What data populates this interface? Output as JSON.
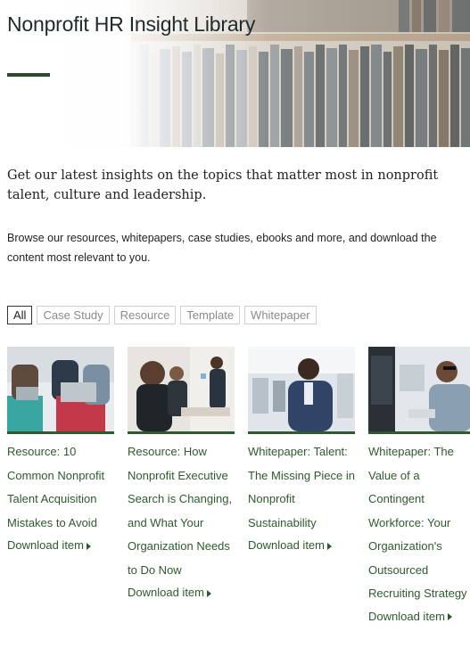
{
  "hero": {
    "title": "Nonprofit HR Insight Library"
  },
  "intro": "Get our latest insights on the topics that matter most in nonprofit talent, culture and leadership.",
  "description": "Browse our resources, whitepapers, case studies, ebooks and more, and download the content most relevant to you.",
  "filters": [
    "All",
    "Case Study",
    "Resource",
    "Template",
    "Whitepaper"
  ],
  "cards": [
    {
      "title": "Resource: 10 Common Nonprofit Talent Acquisition Mistakes to Avoid",
      "download": "Download item"
    },
    {
      "title": "Resource: How Nonprofit Executive Search is Changing, and What Your Organization Needs to Do Now",
      "download": "Download item"
    },
    {
      "title": "Whitepaper: Talent: The Missing Piece in Nonprofit Sustainability",
      "download": "Download item"
    },
    {
      "title": "Whitepaper: The Value of a Contingent Workforce: Your Organization's Outsourced Recruiting Strategy",
      "download": "Download item"
    }
  ],
  "colors": {
    "accent": "#2e5a2e",
    "rule": "#2b4a2a"
  }
}
